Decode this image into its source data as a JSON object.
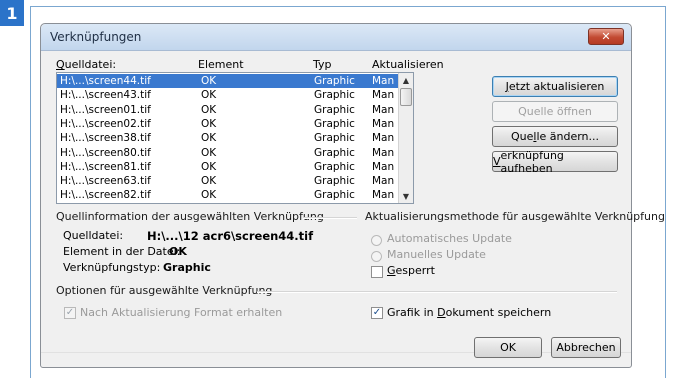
{
  "step_number": "1",
  "dialog": {
    "title": "Verknüpfungen",
    "close_symbol": "✕"
  },
  "columns": {
    "source_prefix": "Q",
    "source_rest": "uelldatei:",
    "element": "Element",
    "type": "Typ",
    "update": "Aktualisieren"
  },
  "rows": [
    {
      "file": "H:\\...\\screen44.tif",
      "element": "OK",
      "type": "Graphic",
      "update": "Man"
    },
    {
      "file": "H:\\...\\screen43.tif",
      "element": "OK",
      "type": "Graphic",
      "update": "Man"
    },
    {
      "file": "H:\\...\\screen01.tif",
      "element": "OK",
      "type": "Graphic",
      "update": "Man"
    },
    {
      "file": "H:\\...\\screen02.tif",
      "element": "OK",
      "type": "Graphic",
      "update": "Man"
    },
    {
      "file": "H:\\...\\screen38.tif",
      "element": "OK",
      "type": "Graphic",
      "update": "Man"
    },
    {
      "file": "H:\\...\\screen80.tif",
      "element": "OK",
      "type": "Graphic",
      "update": "Man"
    },
    {
      "file": "H:\\...\\screen81.tif",
      "element": "OK",
      "type": "Graphic",
      "update": "Man"
    },
    {
      "file": "H:\\...\\screen63.tif",
      "element": "OK",
      "type": "Graphic",
      "update": "Man"
    },
    {
      "file": "H:\\...\\screen82.tif",
      "element": "OK",
      "type": "Graphic",
      "update": "Man"
    }
  ],
  "scroll": {
    "up": "▲",
    "down": "▼"
  },
  "buttons": {
    "update_now_prefix": "J",
    "update_now_rest": "etzt aktualisieren",
    "open_source": "Quelle öffnen",
    "change_source_a": "Que",
    "change_source_u": "l",
    "change_source_b": "le ändern...",
    "break_link_prefix": "V",
    "break_link_rest": "erknüpfung aufheben",
    "ok": "OK",
    "cancel": "Abbrechen"
  },
  "source_info": {
    "section_title": "Quellinformation der ausgewählten Verknüpfung",
    "source_label": "Quelldatei:",
    "source_value": "H:\\...\\12 acr6\\screen44.tif",
    "element_label": "Element in der Datei:",
    "element_value": "OK",
    "type_label": "Verknüpfungstyp:",
    "type_value": "Graphic"
  },
  "update_method": {
    "section_title": "Aktualisierungsmethode für ausgewählte Verknüpfung",
    "auto": "Automatisches Update",
    "manual": "Manuelles Update",
    "locked_prefix": "G",
    "locked_rest": "esperrt"
  },
  "options": {
    "section_title": "Optionen für ausgewählte Verknüpfung",
    "keep_format": "Nach Aktualisierung Format erhalten",
    "store_a": "Grafik in ",
    "store_u": "D",
    "store_b": "okument speichern",
    "check_mark": "✓"
  }
}
